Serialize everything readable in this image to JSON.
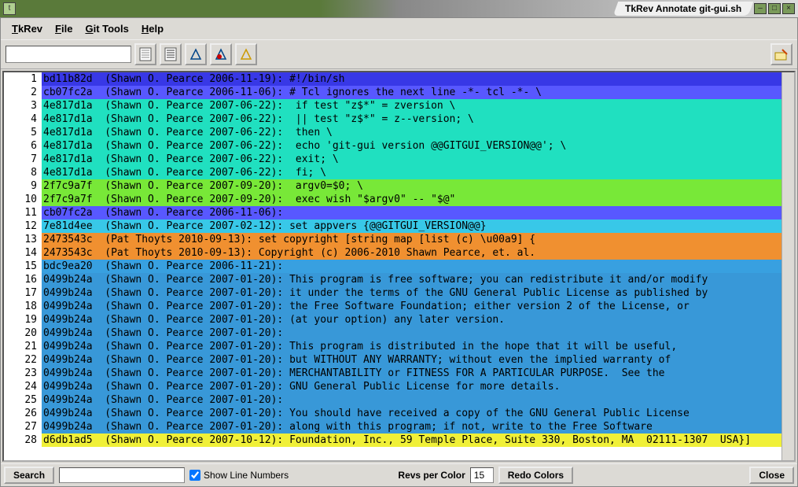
{
  "window": {
    "title": "TkRev Annotate git-gui.sh"
  },
  "menu": {
    "tkrev": "TkRev",
    "file": "File",
    "gittools": "Git Tools",
    "help": "Help"
  },
  "toolbar": {
    "search_value": ""
  },
  "statusbar": {
    "search_btn": "Search",
    "search_value": "",
    "show_line_numbers": "Show Line Numbers",
    "revs_per_color_label": "Revs per Color",
    "revs_per_color_value": "15",
    "redo_colors": "Redo Colors",
    "close": "Close"
  },
  "colors": {
    "c_bd11b82d": "#3838e6",
    "c_cb07fc2a": "#5858ff",
    "c_4e817d1a": "#20e0c0",
    "c_2f7c9a7f": "#78e838",
    "c_7e81d4ee": "#38c8e8",
    "c_2473543c": "#f09030",
    "c_bdc9ea20": "#38a0e0",
    "c_0499b24a": "#3898d8",
    "c_d6db1ad5": "#f0f038"
  },
  "lines": [
    {
      "n": 1,
      "rev": "bd11b82d",
      "auth": "(Shawn O. Pearce 2006-11-19):",
      "txt": " #!/bin/sh",
      "bg": "c_bd11b82d"
    },
    {
      "n": 2,
      "rev": "cb07fc2a",
      "auth": "(Shawn O. Pearce 2006-11-06):",
      "txt": " # Tcl ignores the next line -*- tcl -*- \\",
      "bg": "c_cb07fc2a"
    },
    {
      "n": 3,
      "rev": "4e817d1a",
      "auth": "(Shawn O. Pearce 2007-06-22):",
      "txt": "  if test \"z$*\" = zversion \\",
      "bg": "c_4e817d1a"
    },
    {
      "n": 4,
      "rev": "4e817d1a",
      "auth": "(Shawn O. Pearce 2007-06-22):",
      "txt": "  || test \"z$*\" = z--version; \\",
      "bg": "c_4e817d1a"
    },
    {
      "n": 5,
      "rev": "4e817d1a",
      "auth": "(Shawn O. Pearce 2007-06-22):",
      "txt": "  then \\",
      "bg": "c_4e817d1a"
    },
    {
      "n": 6,
      "rev": "4e817d1a",
      "auth": "(Shawn O. Pearce 2007-06-22):",
      "txt": "  echo 'git-gui version @@GITGUI_VERSION@@'; \\",
      "bg": "c_4e817d1a"
    },
    {
      "n": 7,
      "rev": "4e817d1a",
      "auth": "(Shawn O. Pearce 2007-06-22):",
      "txt": "  exit; \\",
      "bg": "c_4e817d1a"
    },
    {
      "n": 8,
      "rev": "4e817d1a",
      "auth": "(Shawn O. Pearce 2007-06-22):",
      "txt": "  fi; \\",
      "bg": "c_4e817d1a"
    },
    {
      "n": 9,
      "rev": "2f7c9a7f",
      "auth": "(Shawn O. Pearce 2007-09-20):",
      "txt": "  argv0=$0; \\",
      "bg": "c_2f7c9a7f"
    },
    {
      "n": 10,
      "rev": "2f7c9a7f",
      "auth": "(Shawn O. Pearce 2007-09-20):",
      "txt": "  exec wish \"$argv0\" -- \"$@\"",
      "bg": "c_2f7c9a7f"
    },
    {
      "n": 11,
      "rev": "cb07fc2a",
      "auth": "(Shawn O. Pearce 2006-11-06):",
      "txt": "",
      "bg": "c_cb07fc2a"
    },
    {
      "n": 12,
      "rev": "7e81d4ee",
      "auth": "(Shawn O. Pearce 2007-02-12):",
      "txt": " set appvers {@@GITGUI_VERSION@@}",
      "bg": "c_7e81d4ee"
    },
    {
      "n": 13,
      "rev": "2473543c",
      "auth": "(Pat Thoyts 2010-09-13):",
      "txt": " set copyright [string map [list (c) \\u00a9] {",
      "bg": "c_2473543c"
    },
    {
      "n": 14,
      "rev": "2473543c",
      "auth": "(Pat Thoyts 2010-09-13):",
      "txt": " Copyright (c) 2006-2010 Shawn Pearce, et. al.",
      "bg": "c_2473543c"
    },
    {
      "n": 15,
      "rev": "bdc9ea20",
      "auth": "(Shawn O. Pearce 2006-11-21):",
      "txt": "",
      "bg": "c_bdc9ea20"
    },
    {
      "n": 16,
      "rev": "0499b24a",
      "auth": "(Shawn O. Pearce 2007-01-20):",
      "txt": " This program is free software; you can redistribute it and/or modify",
      "bg": "c_0499b24a"
    },
    {
      "n": 17,
      "rev": "0499b24a",
      "auth": "(Shawn O. Pearce 2007-01-20):",
      "txt": " it under the terms of the GNU General Public License as published by",
      "bg": "c_0499b24a"
    },
    {
      "n": 18,
      "rev": "0499b24a",
      "auth": "(Shawn O. Pearce 2007-01-20):",
      "txt": " the Free Software Foundation; either version 2 of the License, or",
      "bg": "c_0499b24a"
    },
    {
      "n": 19,
      "rev": "0499b24a",
      "auth": "(Shawn O. Pearce 2007-01-20):",
      "txt": " (at your option) any later version.",
      "bg": "c_0499b24a"
    },
    {
      "n": 20,
      "rev": "0499b24a",
      "auth": "(Shawn O. Pearce 2007-01-20):",
      "txt": "",
      "bg": "c_0499b24a"
    },
    {
      "n": 21,
      "rev": "0499b24a",
      "auth": "(Shawn O. Pearce 2007-01-20):",
      "txt": " This program is distributed in the hope that it will be useful,",
      "bg": "c_0499b24a"
    },
    {
      "n": 22,
      "rev": "0499b24a",
      "auth": "(Shawn O. Pearce 2007-01-20):",
      "txt": " but WITHOUT ANY WARRANTY; without even the implied warranty of",
      "bg": "c_0499b24a"
    },
    {
      "n": 23,
      "rev": "0499b24a",
      "auth": "(Shawn O. Pearce 2007-01-20):",
      "txt": " MERCHANTABILITY or FITNESS FOR A PARTICULAR PURPOSE.  See the",
      "bg": "c_0499b24a"
    },
    {
      "n": 24,
      "rev": "0499b24a",
      "auth": "(Shawn O. Pearce 2007-01-20):",
      "txt": " GNU General Public License for more details.",
      "bg": "c_0499b24a"
    },
    {
      "n": 25,
      "rev": "0499b24a",
      "auth": "(Shawn O. Pearce 2007-01-20):",
      "txt": "",
      "bg": "c_0499b24a"
    },
    {
      "n": 26,
      "rev": "0499b24a",
      "auth": "(Shawn O. Pearce 2007-01-20):",
      "txt": " You should have received a copy of the GNU General Public License",
      "bg": "c_0499b24a"
    },
    {
      "n": 27,
      "rev": "0499b24a",
      "auth": "(Shawn O. Pearce 2007-01-20):",
      "txt": " along with this program; if not, write to the Free Software",
      "bg": "c_0499b24a"
    },
    {
      "n": 28,
      "rev": "d6db1ad5",
      "auth": "(Shawn O. Pearce 2007-10-12):",
      "txt": " Foundation, Inc., 59 Temple Place, Suite 330, Boston, MA  02111-1307  USA}]",
      "bg": "c_d6db1ad5"
    }
  ]
}
